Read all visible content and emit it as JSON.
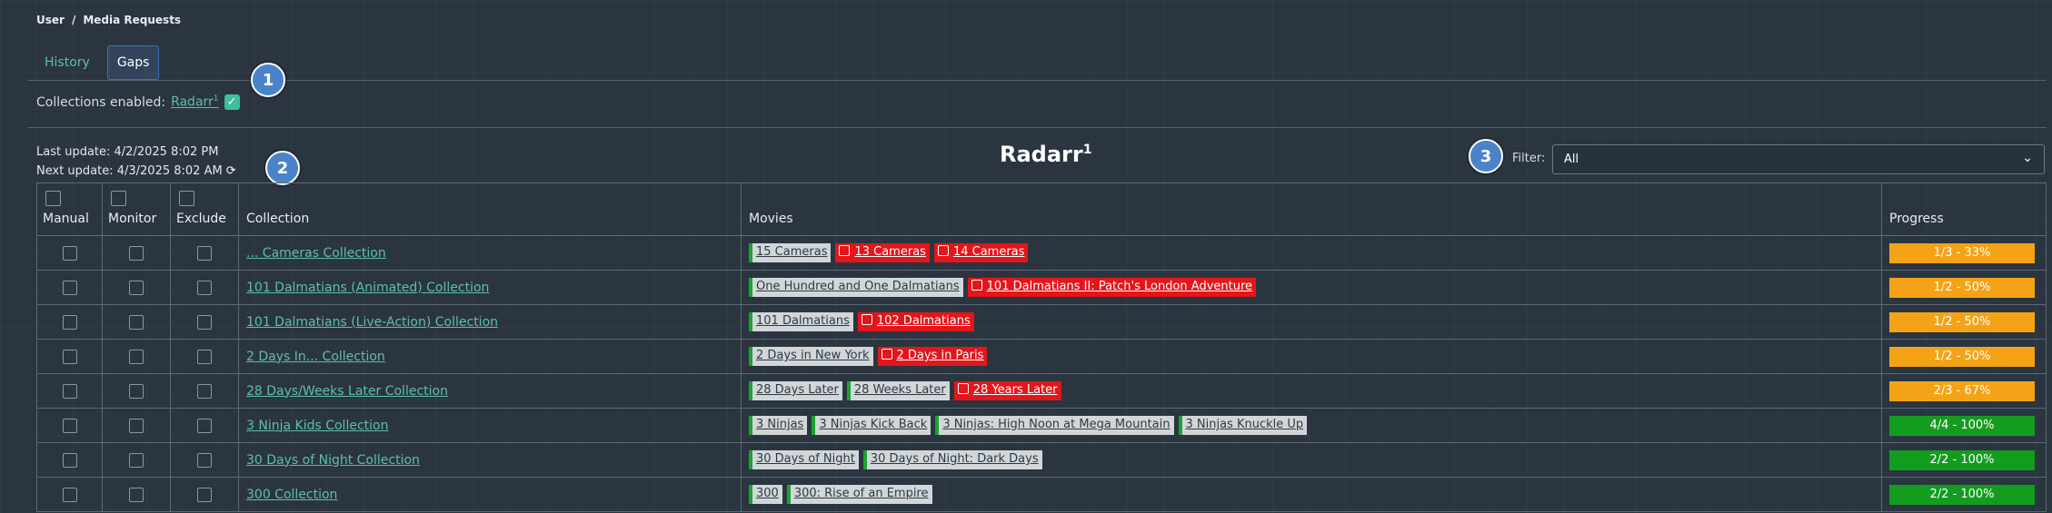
{
  "breadcrumb": {
    "root": "User",
    "sep": "/",
    "current": "Media Requests"
  },
  "tabs": [
    {
      "label": "History"
    },
    {
      "label": "Gaps"
    }
  ],
  "badges": [
    "1",
    "2",
    "3"
  ],
  "collections": {
    "label": "Collections enabled:",
    "link": "Radarr",
    "link_sup": "1"
  },
  "updates": {
    "last": "Last update: 4/2/2025 8:02 PM",
    "next": "Next update: 4/3/2025 8:02 AM"
  },
  "title": {
    "text": "Radarr",
    "sup": "1"
  },
  "filter": {
    "label": "Filter:",
    "value": "All"
  },
  "columns": {
    "manual": "Manual",
    "monitor": "Monitor",
    "exclude": "Exclude",
    "collection": "Collection",
    "movies": "Movies",
    "progress": "Progress"
  },
  "colors": {
    "have": "#d2d6d9",
    "have_marker": "#1aa32e",
    "missing": "#e3161b",
    "partial": "#f5a316",
    "complete": "#149c1f",
    "accent": "#5fbfa8"
  },
  "rows": [
    {
      "collection": "... Cameras Collection",
      "progress": "1/3 - 33%",
      "complete": false,
      "movies": [
        {
          "title": "15 Cameras",
          "have": true
        },
        {
          "title": "13 Cameras",
          "have": false
        },
        {
          "title": "14 Cameras",
          "have": false
        }
      ]
    },
    {
      "collection": "101 Dalmatians (Animated) Collection",
      "progress": "1/2 - 50%",
      "complete": false,
      "movies": [
        {
          "title": "One Hundred and One Dalmatians",
          "have": true
        },
        {
          "title": "101 Dalmatians II: Patch's London Adventure",
          "have": false
        }
      ]
    },
    {
      "collection": "101 Dalmatians (Live-Action) Collection",
      "progress": "1/2 - 50%",
      "complete": false,
      "movies": [
        {
          "title": "101 Dalmatians",
          "have": true
        },
        {
          "title": "102 Dalmatians",
          "have": false
        }
      ]
    },
    {
      "collection": "2 Days In... Collection",
      "progress": "1/2 - 50%",
      "complete": false,
      "movies": [
        {
          "title": "2 Days in New York",
          "have": true
        },
        {
          "title": "2 Days in Paris",
          "have": false
        }
      ]
    },
    {
      "collection": "28 Days/Weeks Later Collection",
      "progress": "2/3 - 67%",
      "complete": false,
      "movies": [
        {
          "title": "28 Days Later",
          "have": true
        },
        {
          "title": "28 Weeks Later",
          "have": true
        },
        {
          "title": "28 Years Later",
          "have": false
        }
      ]
    },
    {
      "collection": "3 Ninja Kids Collection",
      "progress": "4/4 - 100%",
      "complete": true,
      "movies": [
        {
          "title": "3 Ninjas",
          "have": true
        },
        {
          "title": "3 Ninjas Kick Back",
          "have": true
        },
        {
          "title": "3 Ninjas: High Noon at Mega Mountain",
          "have": true
        },
        {
          "title": "3 Ninjas Knuckle Up",
          "have": true
        }
      ]
    },
    {
      "collection": "30 Days of Night Collection",
      "progress": "2/2 - 100%",
      "complete": true,
      "movies": [
        {
          "title": "30 Days of Night",
          "have": true
        },
        {
          "title": "30 Days of Night: Dark Days",
          "have": true
        }
      ]
    },
    {
      "collection": "300 Collection",
      "progress": "2/2 - 100%",
      "complete": true,
      "movies": [
        {
          "title": "300",
          "have": true
        },
        {
          "title": "300: Rise of an Empire",
          "have": true
        }
      ]
    }
  ]
}
